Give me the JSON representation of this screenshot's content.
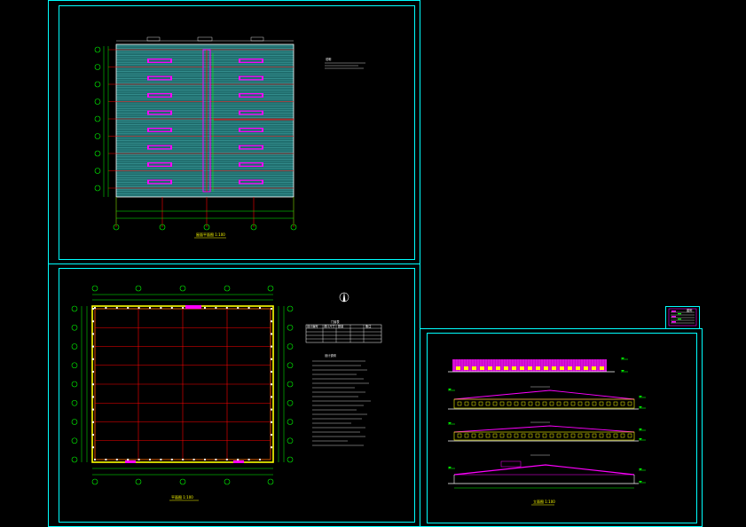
{
  "colors": {
    "background": "#000000",
    "frame": "#00ffff",
    "axis_red": "#ff0000",
    "wall_yellow": "#ffff00",
    "window_magenta": "#ff00ff",
    "roof_teal": "#2e8b8b",
    "dim_green": "#00ff00",
    "text_white": "#ffffff"
  },
  "sheets": {
    "roof_plan": {
      "title": "屋面平面图 1:100"
    },
    "floor_plan": {
      "title": "平面图 1:100"
    },
    "elevations": {
      "title": "立面图 1:100"
    }
  },
  "door_window_table": {
    "title": "门窗表",
    "headers": [
      "设计编号",
      "洞口尺寸",
      "数量",
      "备注"
    ]
  },
  "notes": {
    "roof_plan_note_title": "说明",
    "floor_plan_notes_title": "设计说明"
  },
  "legend": {
    "title": "图例"
  }
}
